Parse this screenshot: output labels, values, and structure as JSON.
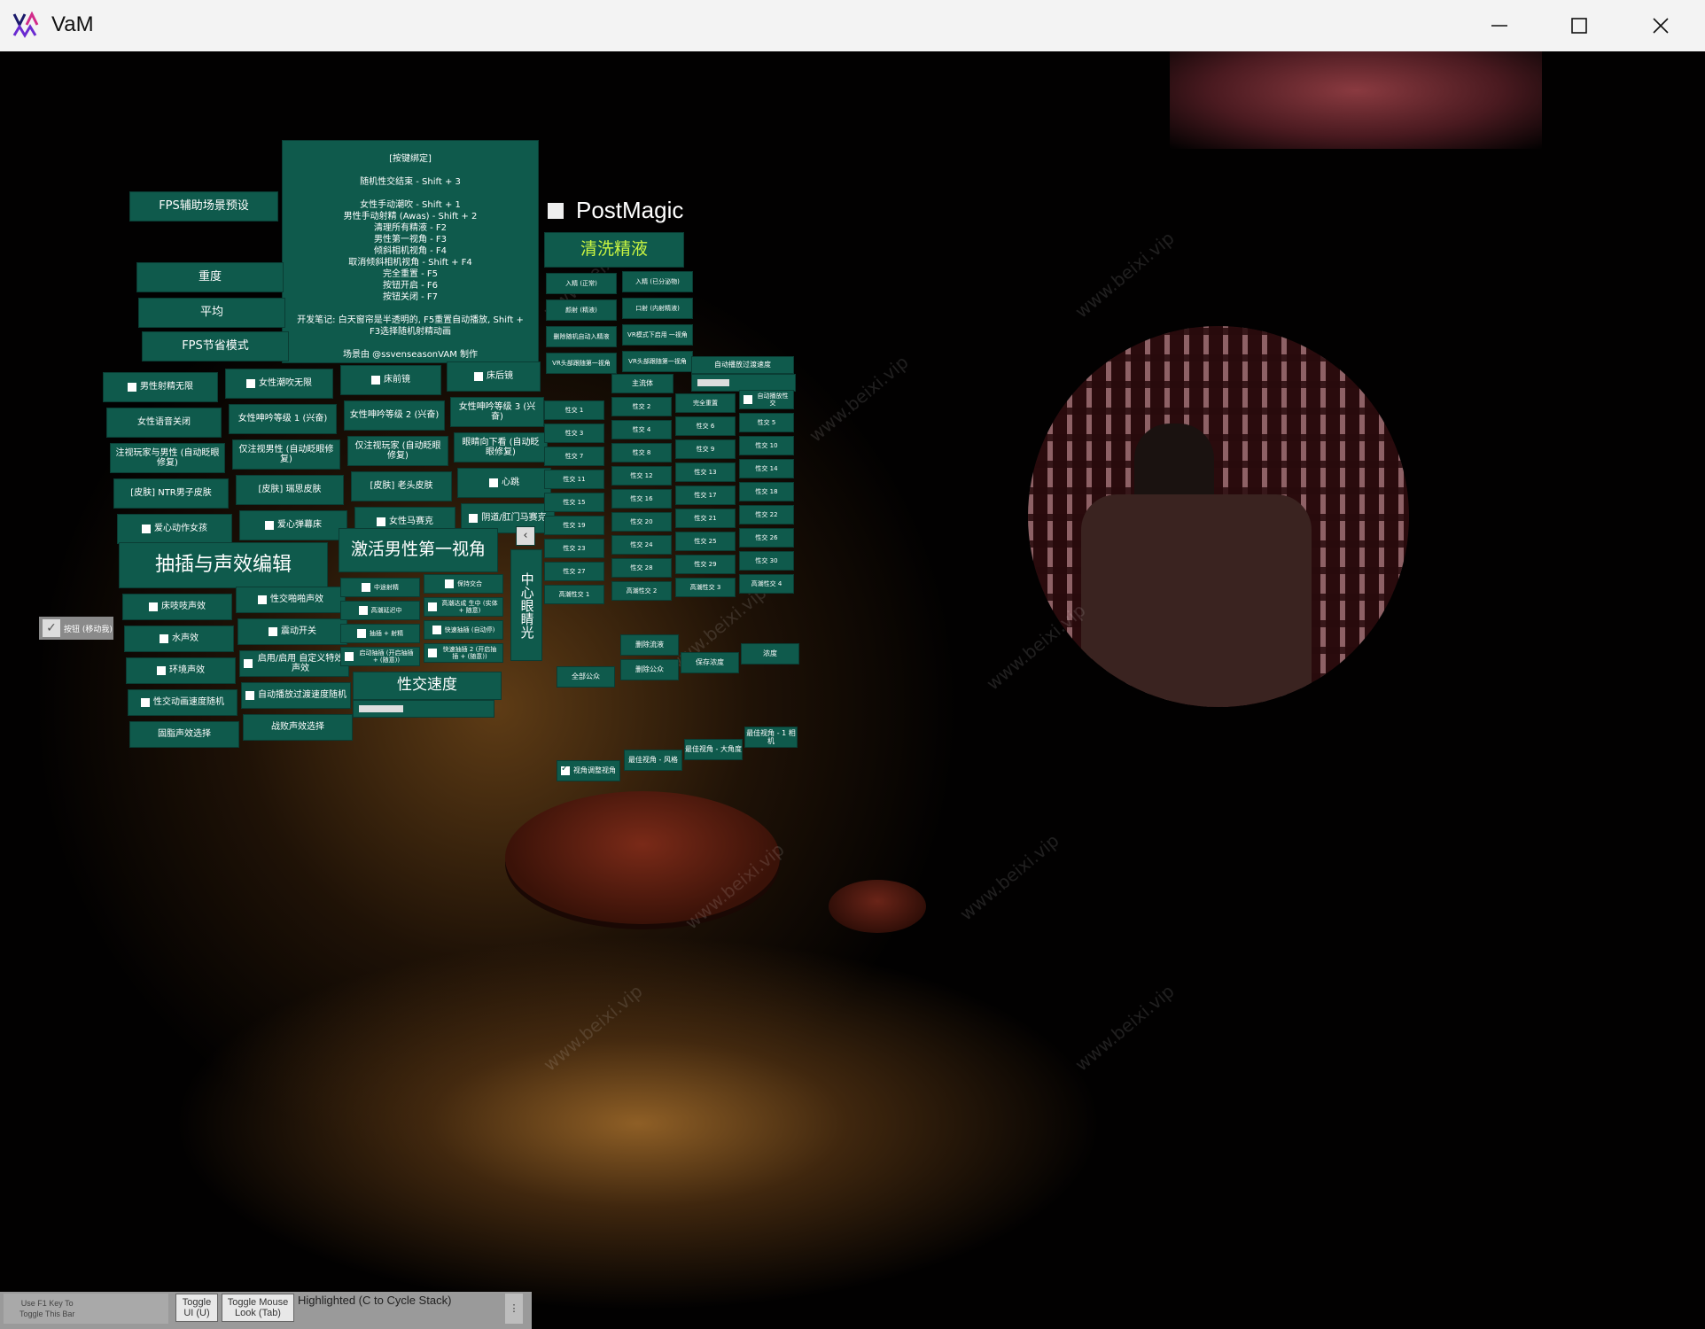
{
  "window": {
    "title": "VaM"
  },
  "postmagic_label": "PostMagic",
  "info_panel_lines": [
    "[按键绑定]",
    "",
    "随机性交结束 - Shift + 3",
    "",
    "女性手动潮吹 - Shift + 1",
    "男性手动射精 (Awas) - Shift + 2",
    "清理所有精液 - F2",
    "男性第一视角 - F3",
    "倾斜相机视角 - F4",
    "取消倾斜相机视角 - Shift + F4",
    "完全重置 - F5",
    "按钮开启 - F6",
    "按钮关闭 - F7",
    "",
    "开发笔记: 白天窗帘是半透明的, F5重置自动播放, Shift +",
    "F3选择随机射精动画",
    "",
    "场景由 @ssvenseasonVAM 制作"
  ],
  "left_buttons": {
    "fps_preset": "FPS辅助场景预设",
    "heavy": "重度",
    "balanced": "平均",
    "fps_saver": "FPS节省模式"
  },
  "grid_left": [
    {
      "label": "男性射精无限",
      "check": true
    },
    {
      "label": "女性潮吹无限",
      "check": true
    },
    {
      "label": "床前镜",
      "check": true
    },
    {
      "label": "床后镜",
      "check": true
    },
    {
      "label": "女性语音关闭",
      "check": false
    },
    {
      "label": "女性呻吟等级 1 (兴奋)",
      "check": false
    },
    {
      "label": "女性呻吟等级 2 (兴奋)",
      "check": false
    },
    {
      "label": "女性呻吟等级 3 (兴奋)",
      "check": false
    },
    {
      "label": "注视玩家与男性 (自动眨眼修复)",
      "check": false
    },
    {
      "label": "仅注视男性 (自动眨眼修复)",
      "check": false
    },
    {
      "label": "仅注视玩家 (自动眨眼修复)",
      "check": false
    },
    {
      "label": "眼睛向下看 (自动眨眼修复)",
      "check": false
    },
    {
      "label": "[皮肤] NTR男子皮肤",
      "check": false
    },
    {
      "label": "[皮肤] 瑞思皮肤",
      "check": false
    },
    {
      "label": "[皮肤] 老头皮肤",
      "check": false
    },
    {
      "label": "心跳",
      "check": true
    },
    {
      "label": "爱心动作女孩",
      "check": true
    },
    {
      "label": "爱心弹幕床",
      "check": true
    },
    {
      "label": "女性马赛克",
      "check": true
    },
    {
      "label": "阴道/肛门马赛克",
      "check": true
    }
  ],
  "headings": {
    "sound_edit": "抽插与声效编辑",
    "male_pov": "激活男性第一视角",
    "clean_fluid": "清洗精液",
    "sex_speed": "性交速度",
    "center_eye": "中心眼睛光",
    "auto_speed": "自动播放过渡速度"
  },
  "sound_items": [
    {
      "label": "床吱吱声效",
      "check": true
    },
    {
      "label": "性交啪啪声效",
      "check": true
    },
    {
      "label": "水声效",
      "check": true
    },
    {
      "label": "震动开关",
      "check": true
    },
    {
      "label": "环境声效",
      "check": true
    },
    {
      "label": "启用/启用 自定义特效声效",
      "check": true
    },
    {
      "label": "性交动画速度随机",
      "check": true
    },
    {
      "label": "自动播放过渡速度随机",
      "check": true
    },
    {
      "label": "固脂声效选择",
      "check": false
    },
    {
      "label": "战败声效选择",
      "check": false
    }
  ],
  "pov_items": [
    {
      "label": "中途射精",
      "check": true
    },
    {
      "label": "保持交合",
      "check": true
    },
    {
      "label": "高潮延迟中",
      "check": true
    },
    {
      "label": "高潮达成 生中 (实体 + 随意)",
      "check": true
    },
    {
      "label": "抽插 + 射精",
      "check": true
    },
    {
      "label": "快速抽插 (自动停)",
      "check": true
    },
    {
      "label": "启动抽插 (开启抽插 + (随意))",
      "check": true
    },
    {
      "label": "快速抽插 2 (开启抽插 + (随意))",
      "check": true
    }
  ],
  "side_toggle": "按钮 (移动我)",
  "mid_buttons": [
    "入精 (正常)",
    "入精 (已分泌物)",
    "颜射 (精液)",
    "口射 (内射精液)",
    "删除随机自动入精液",
    "VR模式下启用 一视角",
    "VR头部跟随第一视角",
    "VR头部跟随第一视角"
  ],
  "main_fluid": "主流体",
  "positions": [
    "性交 1",
    "性交 2",
    "完全重置",
    "自动播放性交",
    "性交 3",
    "性交 4",
    "性交 6",
    "性交 5",
    "性交 7",
    "性交 8",
    "性交 9",
    "性交 10",
    "性交 11",
    "性交 12",
    "性交 13",
    "性交 14",
    "性交 15",
    "性交 16",
    "性交 17",
    "性交 18",
    "性交 19",
    "性交 20",
    "性交 21",
    "性交 22",
    "性交 23",
    "性交 24",
    "性交 25",
    "性交 26",
    "性交 27",
    "性交 28",
    "性交 29",
    "性交 30",
    "高潮性交 1",
    "高潮性交 2",
    "高潮性交 3",
    "高潮性交 4"
  ],
  "lower_buttons": [
    "删除流液",
    "全部公众",
    "删除公众",
    "保存浓度",
    "浓度"
  ],
  "bottom_row": [
    "视角调整视角",
    "最佳视角 - 风格",
    "最佳视角 - 大角度",
    "最佳视角 - 1 相机"
  ],
  "status_bar": {
    "f1_hint_line1": "Use F1 Key To",
    "f1_hint_line2": "Toggle This Bar",
    "toggle_ui_line1": "Toggle",
    "toggle_ui_line2": "UI (U)",
    "toggle_mouse_line1": "Toggle Mouse",
    "toggle_mouse_line2": "Look (Tab)",
    "highlighted": "Highlighted (C to Cycle Stack)"
  },
  "colors": {
    "panel": "#0f5a4c",
    "title_text": "#c9f542"
  }
}
